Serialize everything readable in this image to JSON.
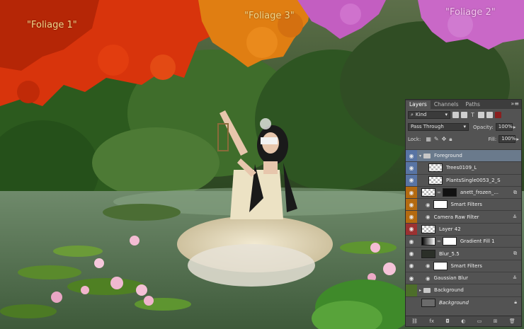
{
  "canvas": {
    "labels": {
      "foliage1": "\"Foliage 1\"",
      "foliage2": "\"Foliage 2\"",
      "foliage3": "\"Foliage 3\""
    }
  },
  "panel": {
    "tabs": [
      "Layers",
      "Channels",
      "Paths"
    ],
    "menu_icon": "panel-menu-icon",
    "filter_kind": "Kind",
    "blend_mode": "Pass Through",
    "opacity_label": "Opacity:",
    "opacity_value": "100%",
    "lock_label": "Lock:",
    "fill_label": "Fill:",
    "fill_value": "100%",
    "layers": [
      {
        "name": "Foreground",
        "type": "group",
        "color": "blue",
        "selected": true
      },
      {
        "name": "Trees0109_L",
        "type": "layer",
        "color": "blue"
      },
      {
        "name": "PlantsSingle0053_2_S",
        "type": "layer",
        "color": "blue"
      },
      {
        "name": "anett_frozen_...",
        "type": "smart",
        "color": "orange"
      },
      {
        "name": "Smart Filters",
        "type": "filtergroup",
        "color": "orange"
      },
      {
        "name": "Camera Raw Filter",
        "type": "filter",
        "color": "orange"
      },
      {
        "name": "Layer 42",
        "type": "layer",
        "color": "red"
      },
      {
        "name": "Gradient Fill 1",
        "type": "fill",
        "color": "grey"
      },
      {
        "name": "Blur_5.5",
        "type": "smart",
        "color": "grey"
      },
      {
        "name": "Smart Filters",
        "type": "filtergroup",
        "color": "grey"
      },
      {
        "name": "Gaussian Blur",
        "type": "filter",
        "color": "grey"
      },
      {
        "name": "Background",
        "type": "group",
        "color": "green"
      },
      {
        "name": "Background",
        "type": "background",
        "color": "grey"
      }
    ],
    "footer_icons": [
      "link-icon",
      "fx-icon",
      "mask-icon",
      "adjustment-icon",
      "folder-icon",
      "new-layer-icon",
      "trash-icon"
    ]
  }
}
